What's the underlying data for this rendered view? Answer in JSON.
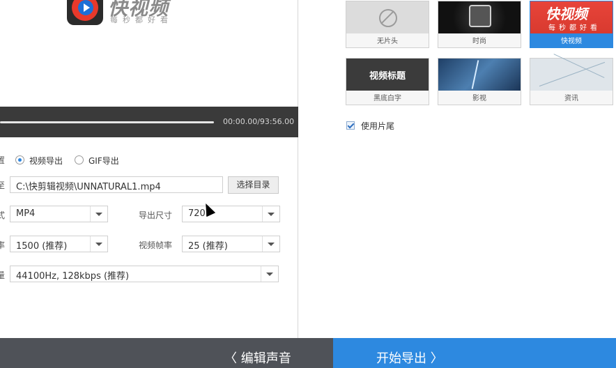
{
  "brand": {
    "name": "快视频",
    "slogan": "每秒都好看"
  },
  "player": {
    "time": "00:00.00/93:56.00",
    "progress": 0
  },
  "form": {
    "edge_chars": [
      "置",
      "至",
      "式",
      "率",
      "量"
    ],
    "radio_video": "视频导出",
    "radio_gif": "GIF导出",
    "path_value": "C:\\快剪辑视频\\UNNATURAL1.mp4",
    "choose_dir": "选择目录",
    "format_value": "MP4",
    "size_label": "导出尺寸",
    "size_value": "720P",
    "bitrate_value": "1500 (推荐)",
    "fps_label": "视频帧率",
    "fps_value": "25 (推荐)",
    "audio_value": "44100Hz, 128kbps (推荐)"
  },
  "bottom": {
    "back": "编辑声音",
    "start": "开始导出"
  },
  "templates": [
    {
      "caption": "无片头",
      "img_text": ""
    },
    {
      "caption": "时尚",
      "img_text": ""
    },
    {
      "caption": "快视频",
      "img_text": "快视频",
      "img_sub": "每秒都好看"
    },
    {
      "caption": "黑底白字",
      "img_text": "视频标题"
    },
    {
      "caption": "影视",
      "img_text": ""
    },
    {
      "caption": "资讯",
      "img_text": ""
    }
  ],
  "use_ending": "使用片尾",
  "colors": {
    "accent": "#2d89e0",
    "player_bg": "#3a3a3a",
    "bottom_bg": "#4f5258"
  }
}
